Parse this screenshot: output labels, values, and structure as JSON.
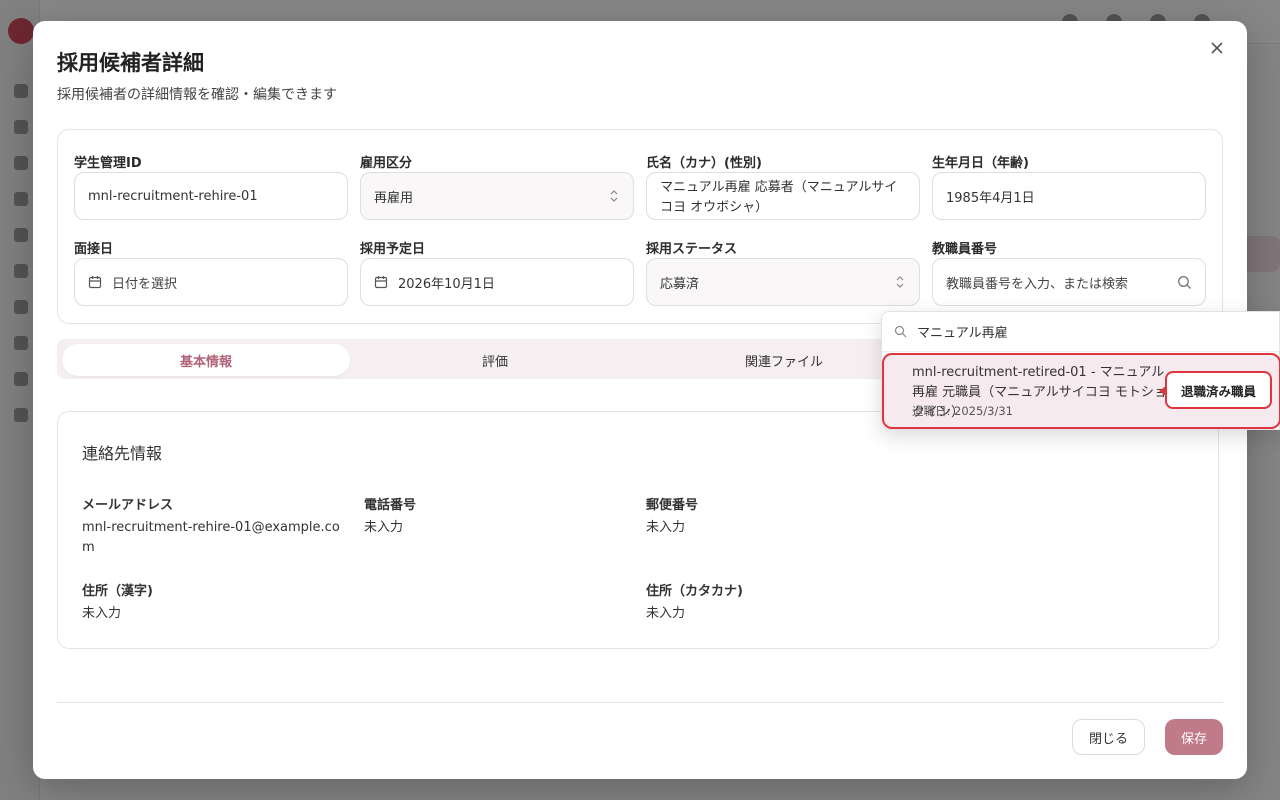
{
  "modal": {
    "title": "採用候補者詳細",
    "description": "採用候補者の詳細情報を確認・編集できます"
  },
  "form": {
    "student_id": {
      "label": "学生管理ID",
      "value": "mnl-recruitment-rehire-01"
    },
    "employment_type": {
      "label": "雇用区分",
      "value": "再雇用"
    },
    "name": {
      "label": "氏名（カナ）(性別)",
      "value": "マニュアル再雇 応募者（マニュアルサイコヨ オウボシャ）"
    },
    "birthdate": {
      "label": "生年月日（年齢)",
      "value": "1985年4月1日"
    },
    "interview_date": {
      "label": "面接日",
      "placeholder": "日付を選択"
    },
    "hire_date": {
      "label": "採用予定日",
      "value": "2026年10月1日"
    },
    "status": {
      "label": "採用ステータス",
      "value": "応募済"
    },
    "staff_number": {
      "label": "教職員番号",
      "placeholder": "教職員番号を入力、または検索"
    }
  },
  "tabs": [
    "基本情報",
    "評価",
    "関連ファイル"
  ],
  "contact": {
    "title": "連絡先情報",
    "email": {
      "label": "メールアドレス",
      "value": "mnl-recruitment-rehire-01@example.com"
    },
    "phone": {
      "label": "電話番号",
      "value": "未入力"
    },
    "postal": {
      "label": "郵便番号",
      "value": "未入力"
    },
    "address_kanji": {
      "label": "住所（漢字)",
      "value": "未入力"
    },
    "address_kana": {
      "label": "住所（カタカナ)",
      "value": "未入力"
    }
  },
  "footer": {
    "close_label": "閉じる",
    "save_label": "保存"
  },
  "dropdown": {
    "query": "マニュアル再雇",
    "option": {
      "title": "mnl-recruitment-retired-01 - マニュアル再雇 元職員（マニュアルサイコヨ モトショクイン）",
      "sub": "退職日: 2025/3/31"
    },
    "badge": "退職済み職員"
  },
  "colors": {
    "accent": "#c07a88",
    "highlight": "#e0343f"
  }
}
